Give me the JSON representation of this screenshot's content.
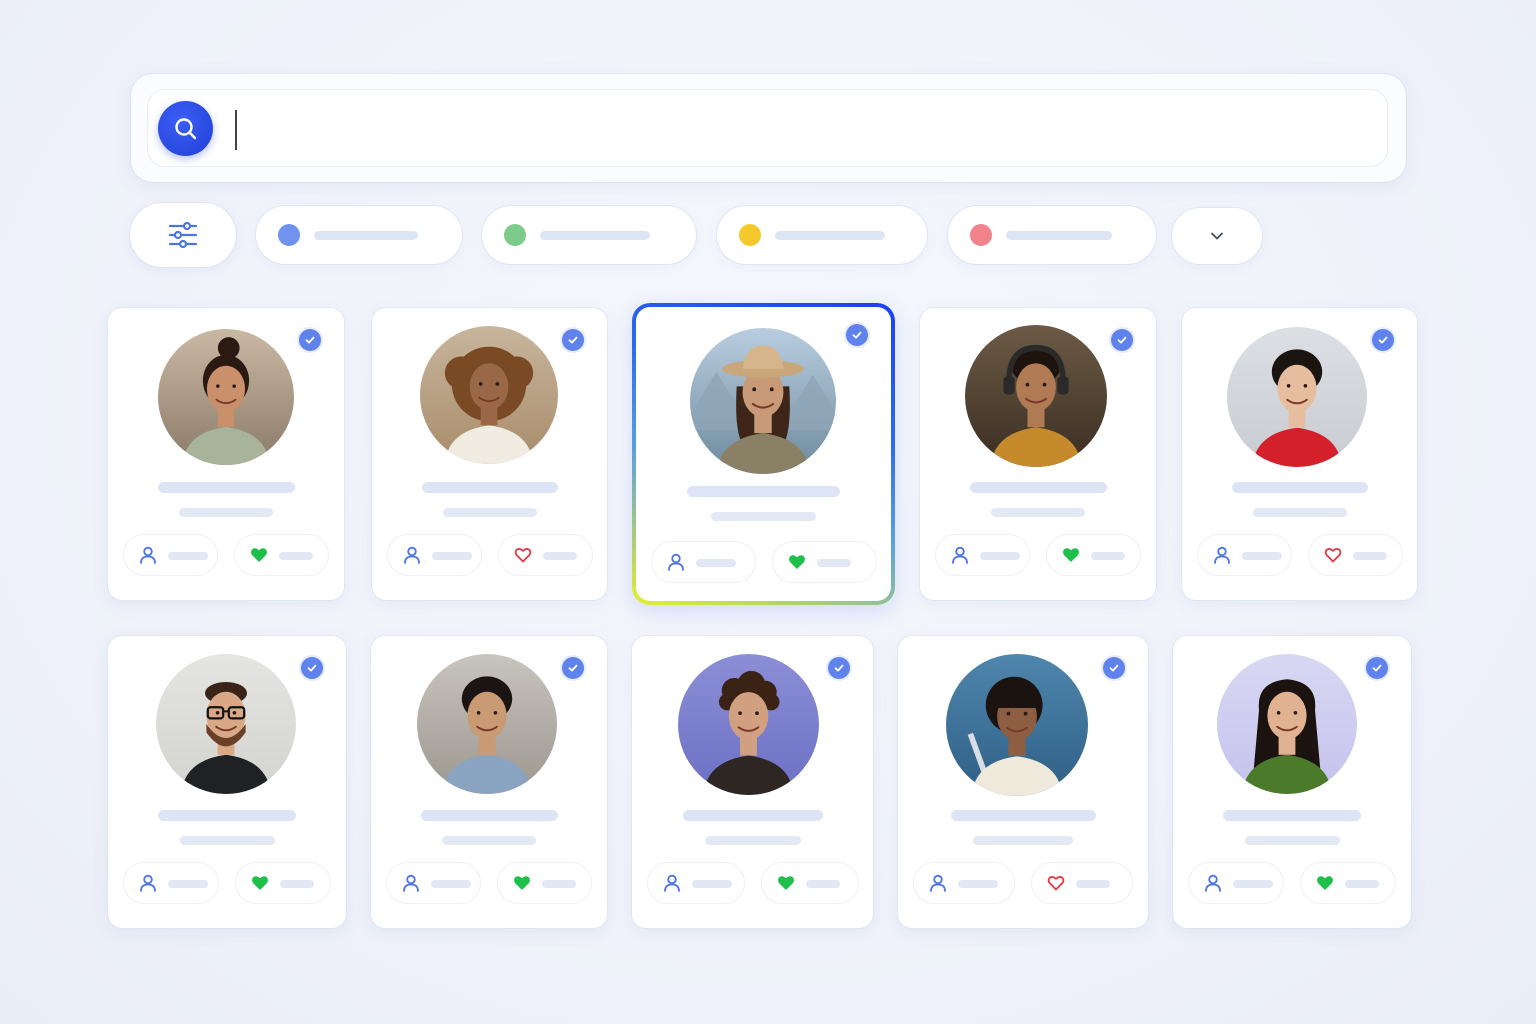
{
  "search": {
    "value": "",
    "placeholder": ""
  },
  "toolbar": {
    "filter_icon": "sliders-icon",
    "more_icon": "chevron-down-icon"
  },
  "filter_chips": [
    {
      "color": "#6f93ee"
    },
    {
      "color": "#7dcb8a"
    },
    {
      "color": "#f5c92b"
    },
    {
      "color": "#f2838d"
    }
  ],
  "colors": {
    "accent": "#2346e6",
    "verified": "#5f82ec",
    "heart_liked": "#1ec04a",
    "heart_unliked": "#e53945",
    "person_icon": "#4d74e0"
  },
  "profiles": [
    {
      "verified": true,
      "liked": true,
      "selected": false,
      "avatar": "woman-bun-kitchen"
    },
    {
      "verified": true,
      "liked": false,
      "selected": false,
      "avatar": "woman-curly-hair"
    },
    {
      "verified": true,
      "liked": true,
      "selected": true,
      "avatar": "woman-hat-mountains"
    },
    {
      "verified": true,
      "liked": true,
      "selected": false,
      "avatar": "man-headphones-hoodie"
    },
    {
      "verified": true,
      "liked": false,
      "selected": false,
      "avatar": "woman-red-sweater"
    },
    {
      "verified": true,
      "liked": true,
      "selected": false,
      "avatar": "man-beard-glasses"
    },
    {
      "verified": true,
      "liked": true,
      "selected": false,
      "avatar": "man-denim-shirt"
    },
    {
      "verified": true,
      "liked": true,
      "selected": false,
      "avatar": "young-man-curly"
    },
    {
      "verified": true,
      "liked": false,
      "selected": false,
      "avatar": "woman-bangs-guitar"
    },
    {
      "verified": true,
      "liked": true,
      "selected": false,
      "avatar": "woman-laughing-green"
    }
  ]
}
